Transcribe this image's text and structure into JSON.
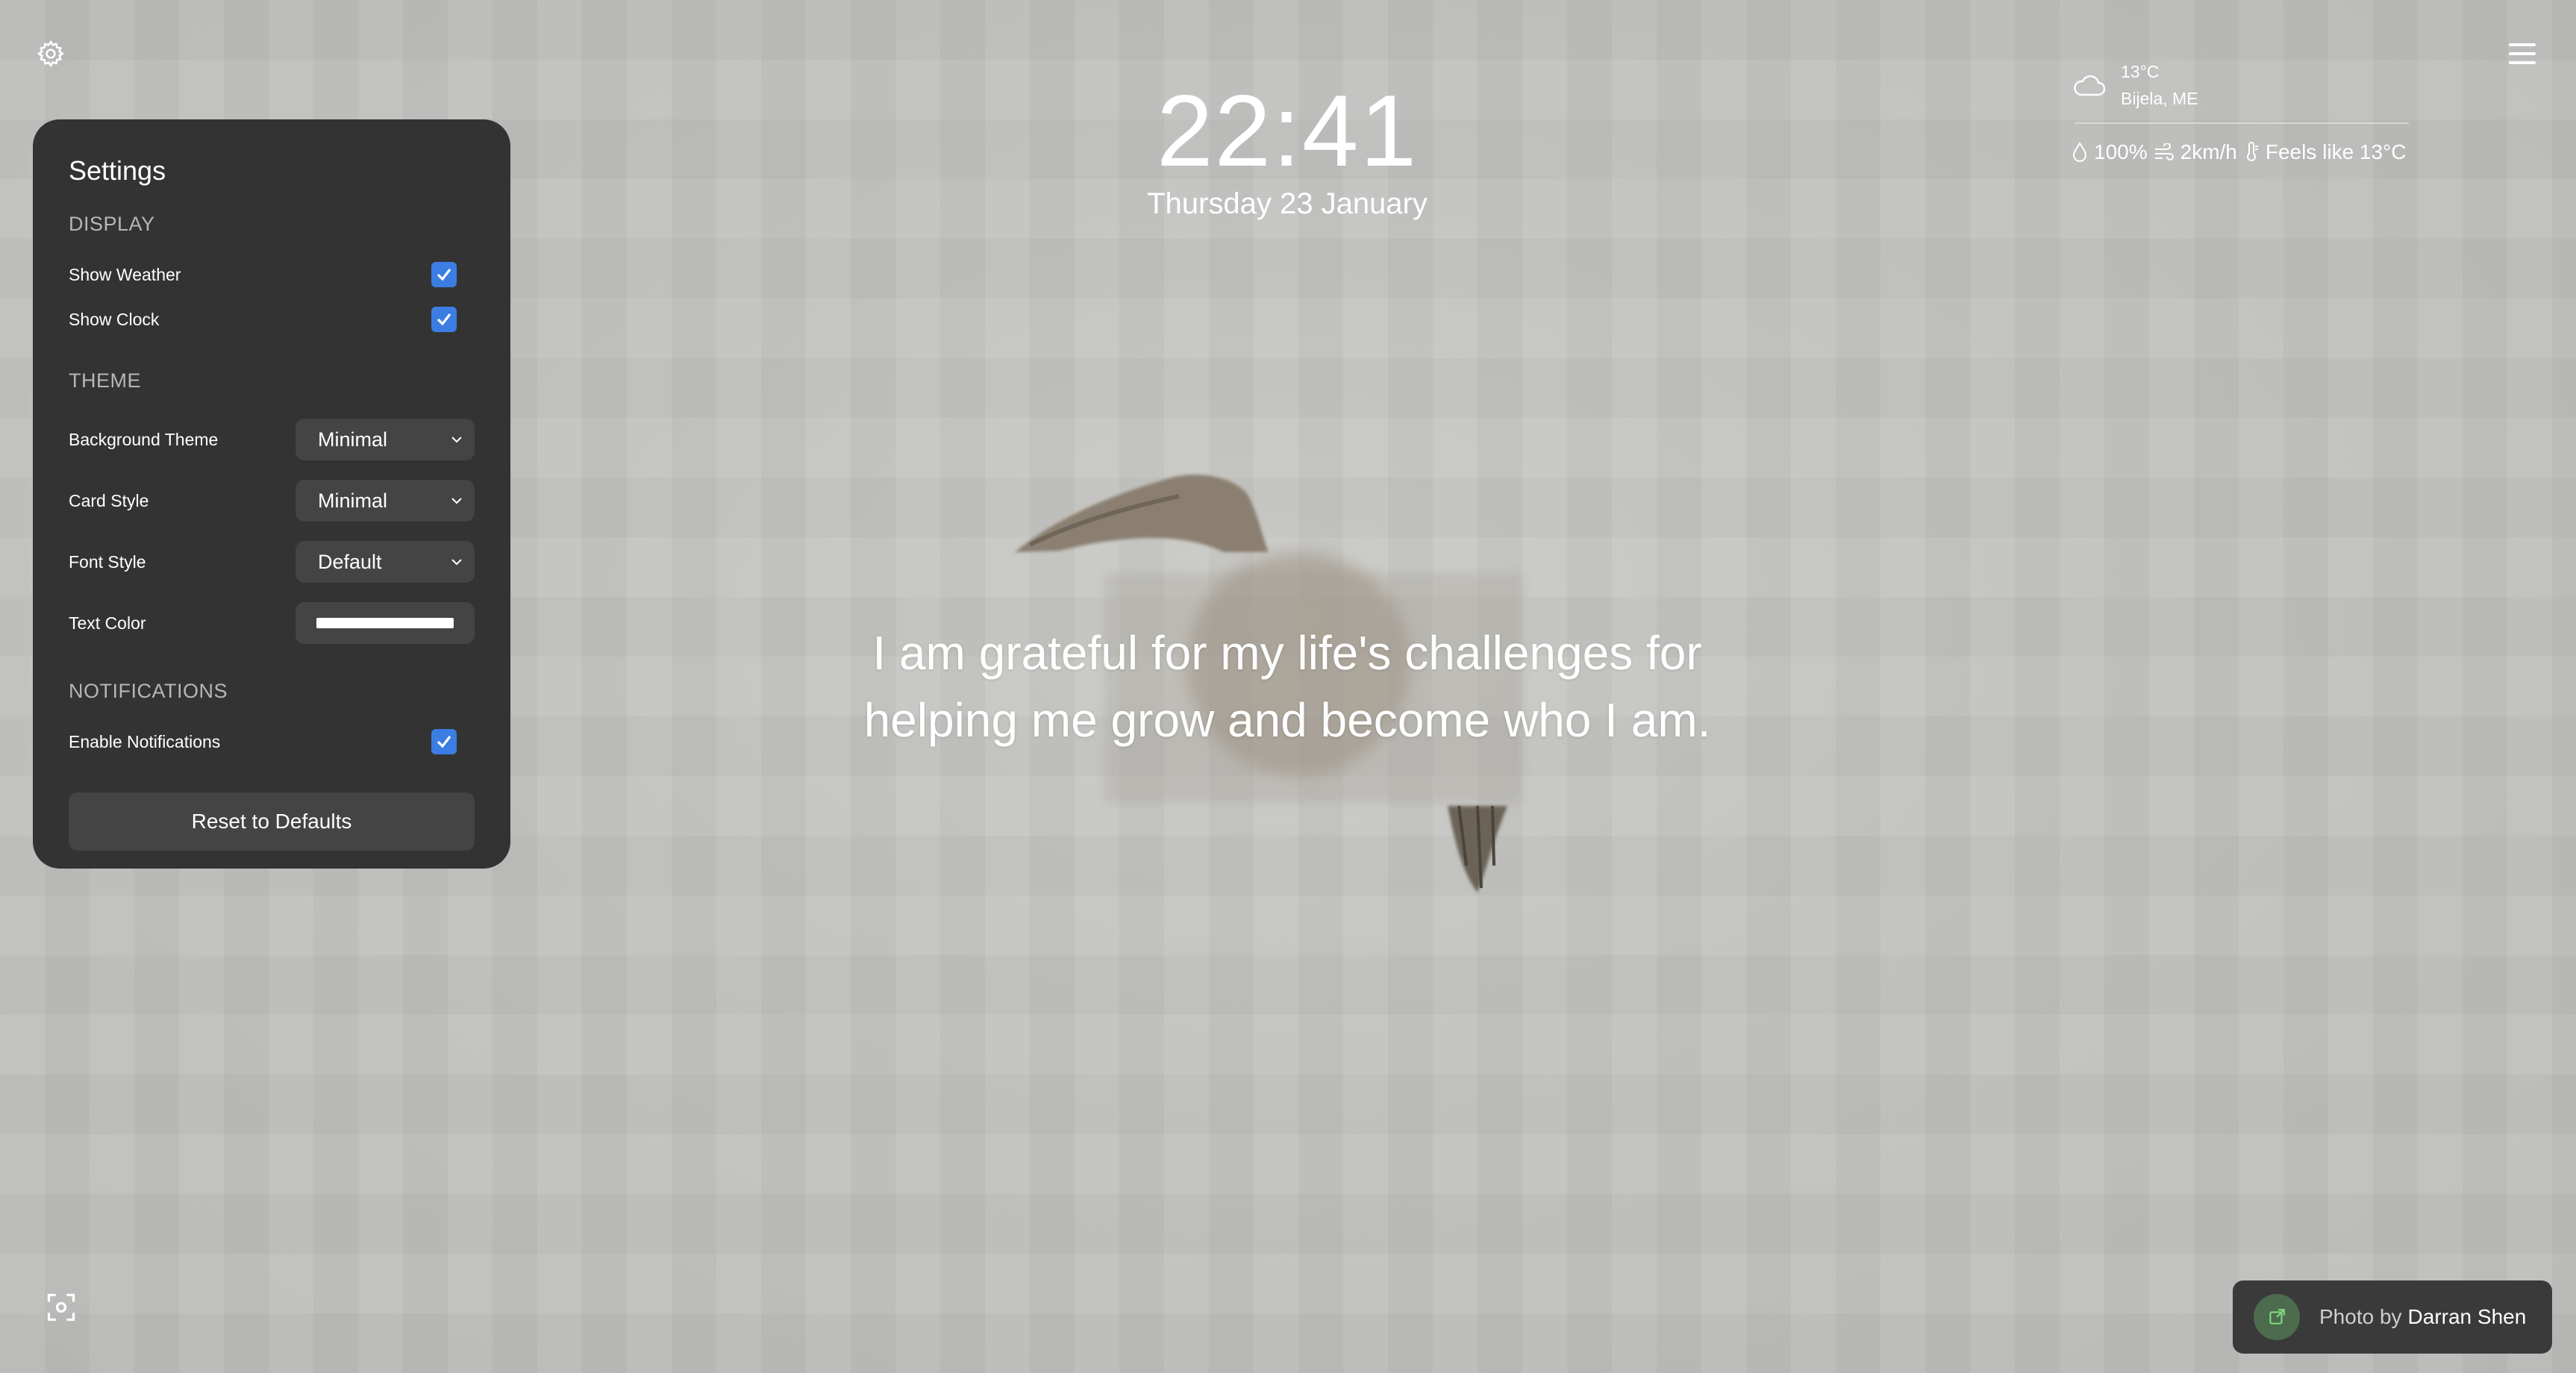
{
  "clock": {
    "time": "22:41",
    "date": "Thursday 23 January"
  },
  "weather": {
    "icon": "cloud-icon",
    "temperature": "13°C",
    "location": "Bijela, ME",
    "humidity": "100%",
    "wind": "2km/h",
    "feels_like": "Feels like 13°C"
  },
  "quote": "I am grateful for my life's challenges for helping me grow and become who I am.",
  "settings": {
    "title": "Settings",
    "display": {
      "title": "DISPLAY",
      "show_weather_label": "Show Weather",
      "show_weather": true,
      "show_clock_label": "Show Clock",
      "show_clock": true
    },
    "theme": {
      "title": "THEME",
      "background_theme_label": "Background Theme",
      "background_theme_value": "Minimal",
      "card_style_label": "Card Style",
      "card_style_value": "Minimal",
      "font_style_label": "Font Style",
      "font_style_value": "Default",
      "text_color_label": "Text Color",
      "text_color_value": "#ffffff"
    },
    "notifications": {
      "title": "NOTIFICATIONS",
      "enable_label": "Enable Notifications",
      "enabled": true
    },
    "reset_label": "Reset to Defaults"
  },
  "credit": {
    "prefix": "Photo by",
    "author": "Darran Shen"
  },
  "colors": {
    "panel": "#333333",
    "accent": "#3b7de2",
    "control": "#444444"
  }
}
